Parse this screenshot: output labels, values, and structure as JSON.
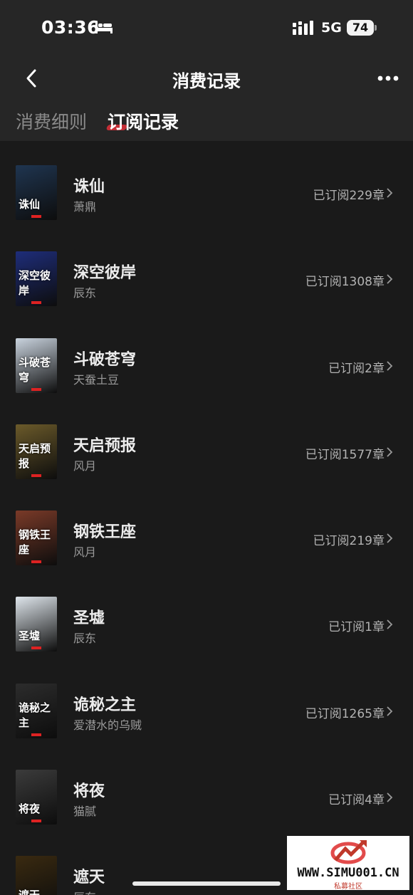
{
  "status_bar": {
    "time": "03:36",
    "network": "5G",
    "battery": "74"
  },
  "header": {
    "title": "消费记录"
  },
  "tabs": [
    {
      "label": "消费细则",
      "active": false
    },
    {
      "label": "订阅记录",
      "active": true
    }
  ],
  "books": [
    {
      "title": "诛仙",
      "author": "萧鼎",
      "subscribed": "已订阅229章",
      "cover_text": "诛仙",
      "cover_color": "#1f3550"
    },
    {
      "title": "深空彼岸",
      "author": "辰东",
      "subscribed": "已订阅1308章",
      "cover_text": "深空彼岸",
      "cover_color": "#1e2d7a"
    },
    {
      "title": "斗破苍穹",
      "author": "天蚕土豆",
      "subscribed": "已订阅2章",
      "cover_text": "斗破苍穹",
      "cover_color": "#c9d3de"
    },
    {
      "title": "天启预报",
      "author": "风月",
      "subscribed": "已订阅1577章",
      "cover_text": "天启预报",
      "cover_color": "#6b5a2a"
    },
    {
      "title": "钢铁王座",
      "author": "风月",
      "subscribed": "已订阅219章",
      "cover_text": "钢铁王座",
      "cover_color": "#7a3a28"
    },
    {
      "title": "圣墟",
      "author": "辰东",
      "subscribed": "已订阅1章",
      "cover_text": "圣墟",
      "cover_color": "#dfe6ec"
    },
    {
      "title": "诡秘之主",
      "author": "爱潜水的乌贼",
      "subscribed": "已订阅1265章",
      "cover_text": "诡秘之主",
      "cover_color": "#2c2c2c"
    },
    {
      "title": "将夜",
      "author": "猫腻",
      "subscribed": "已订阅4章",
      "cover_text": "将夜",
      "cover_color": "#3b3b3b"
    },
    {
      "title": "遮天",
      "author": "辰东",
      "subscribed": "",
      "cover_text": "遮天",
      "cover_color": "#3a2a10"
    }
  ],
  "watermark": {
    "text": "WWW.SIMU001.CN",
    "sub": "私募社区"
  }
}
